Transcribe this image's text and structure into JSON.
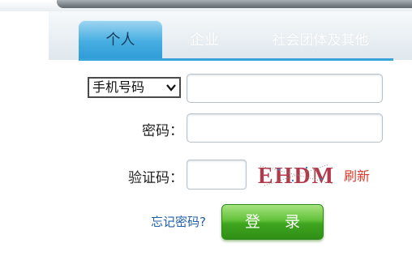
{
  "tabs": [
    {
      "label": "个人",
      "active": true
    },
    {
      "label": "企业",
      "active": false
    },
    {
      "label": "社会团体及其他",
      "active": false
    }
  ],
  "form": {
    "account_type_selected": "手机号码",
    "phone_value": "",
    "password_label": "密码：",
    "password_value": "",
    "captcha_label": "验证码：",
    "captcha_value": "",
    "captcha_image_text": "EHDM",
    "refresh_label": "刷新",
    "forgot_label": "忘记密码?",
    "login_label": "登 录"
  },
  "colors": {
    "tab_active": "#46aee2",
    "login_button": "#4fb52a",
    "refresh_link": "#d83a2b",
    "forgot_link": "#1f5fa8"
  },
  "icons": {
    "select_arrow": "chevron-down-icon"
  }
}
